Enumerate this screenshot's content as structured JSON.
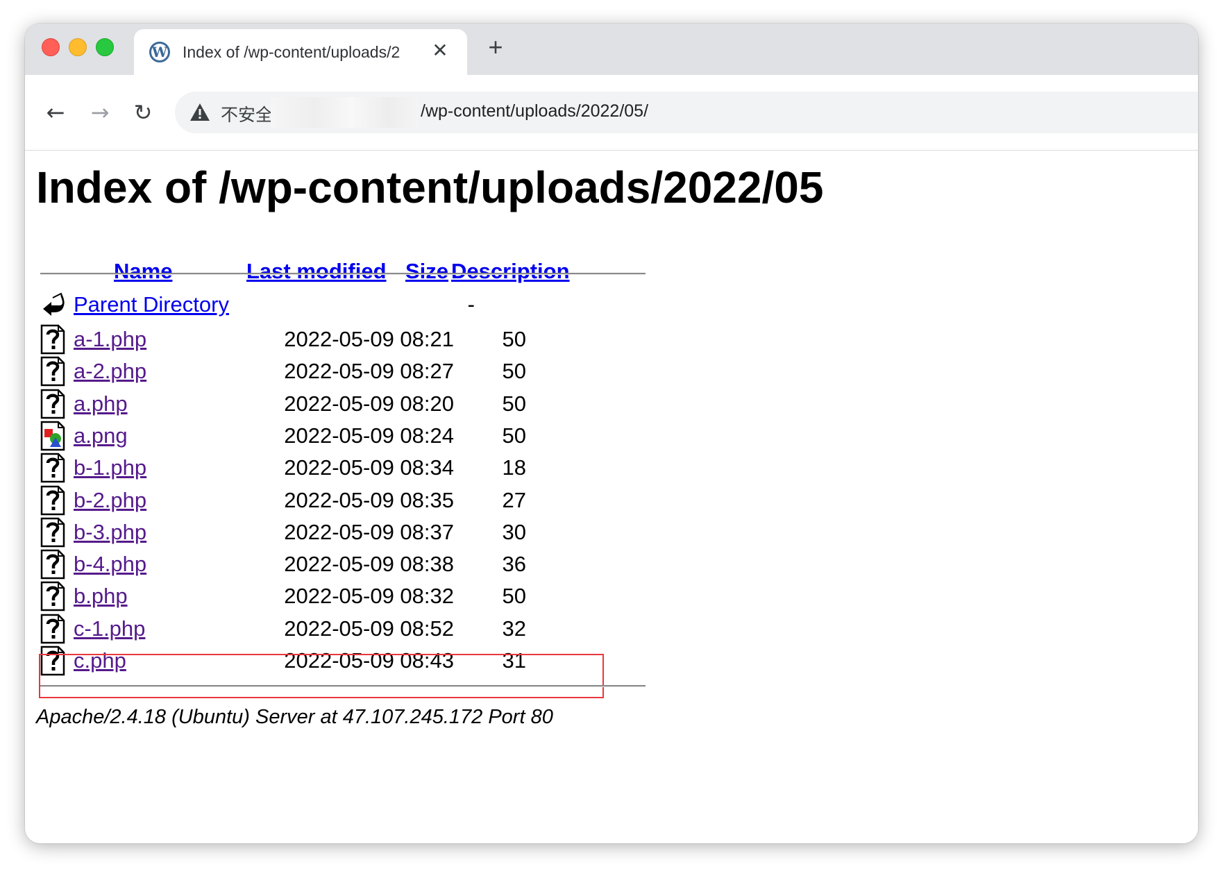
{
  "browser": {
    "tab_title": "Index of /wp-content/uploads/2",
    "tab_favicon": "W",
    "security_label": "不安全",
    "url_suffix": "/wp-content/uploads/2022/05/",
    "icons": {
      "favicon": "wordpress-icon",
      "close": "close-icon",
      "new_tab": "plus-icon",
      "back": "arrow-left-icon",
      "forward": "arrow-right-icon",
      "reload": "reload-icon",
      "warning": "warning-triangle-icon"
    },
    "glyphs": {
      "close": "✕",
      "new_tab": "+",
      "back": "←",
      "forward": "→",
      "reload": "↻"
    }
  },
  "page": {
    "title": "Index of /wp-content/uploads/2022/05",
    "columns": {
      "name": "Name",
      "last_modified": "Last modified",
      "size": "Size",
      "description": "Description"
    },
    "parent": {
      "label": "Parent Directory",
      "size": "-"
    },
    "files": [
      {
        "name": "a-1.php",
        "modified": "2022-05-09 08:21",
        "size": "50",
        "icon": "unknown-file-icon"
      },
      {
        "name": "a-2.php",
        "modified": "2022-05-09 08:27",
        "size": "50",
        "icon": "unknown-file-icon"
      },
      {
        "name": "a.php",
        "modified": "2022-05-09 08:20",
        "size": "50",
        "icon": "unknown-file-icon"
      },
      {
        "name": "a.png",
        "modified": "2022-05-09 08:24",
        "size": "50",
        "icon": "image-file-icon"
      },
      {
        "name": "b-1.php",
        "modified": "2022-05-09 08:34",
        "size": "18",
        "icon": "unknown-file-icon"
      },
      {
        "name": "b-2.php",
        "modified": "2022-05-09 08:35",
        "size": "27",
        "icon": "unknown-file-icon"
      },
      {
        "name": "b-3.php",
        "modified": "2022-05-09 08:37",
        "size": "30",
        "icon": "unknown-file-icon"
      },
      {
        "name": "b-4.php",
        "modified": "2022-05-09 08:38",
        "size": "36",
        "icon": "unknown-file-icon"
      },
      {
        "name": "b.php",
        "modified": "2022-05-09 08:32",
        "size": "50",
        "icon": "unknown-file-icon"
      },
      {
        "name": "c-1.php",
        "modified": "2022-05-09 08:52",
        "size": "32",
        "icon": "unknown-file-icon"
      },
      {
        "name": "c.php",
        "modified": "2022-05-09 08:43",
        "size": "31",
        "icon": "unknown-file-icon"
      }
    ],
    "footer": "Apache/2.4.18 (Ubuntu) Server at 47.107.245.172 Port 80",
    "colors": {
      "link": "#0000ee",
      "visited": "#551a8b",
      "highlight": "#e8373c"
    }
  }
}
